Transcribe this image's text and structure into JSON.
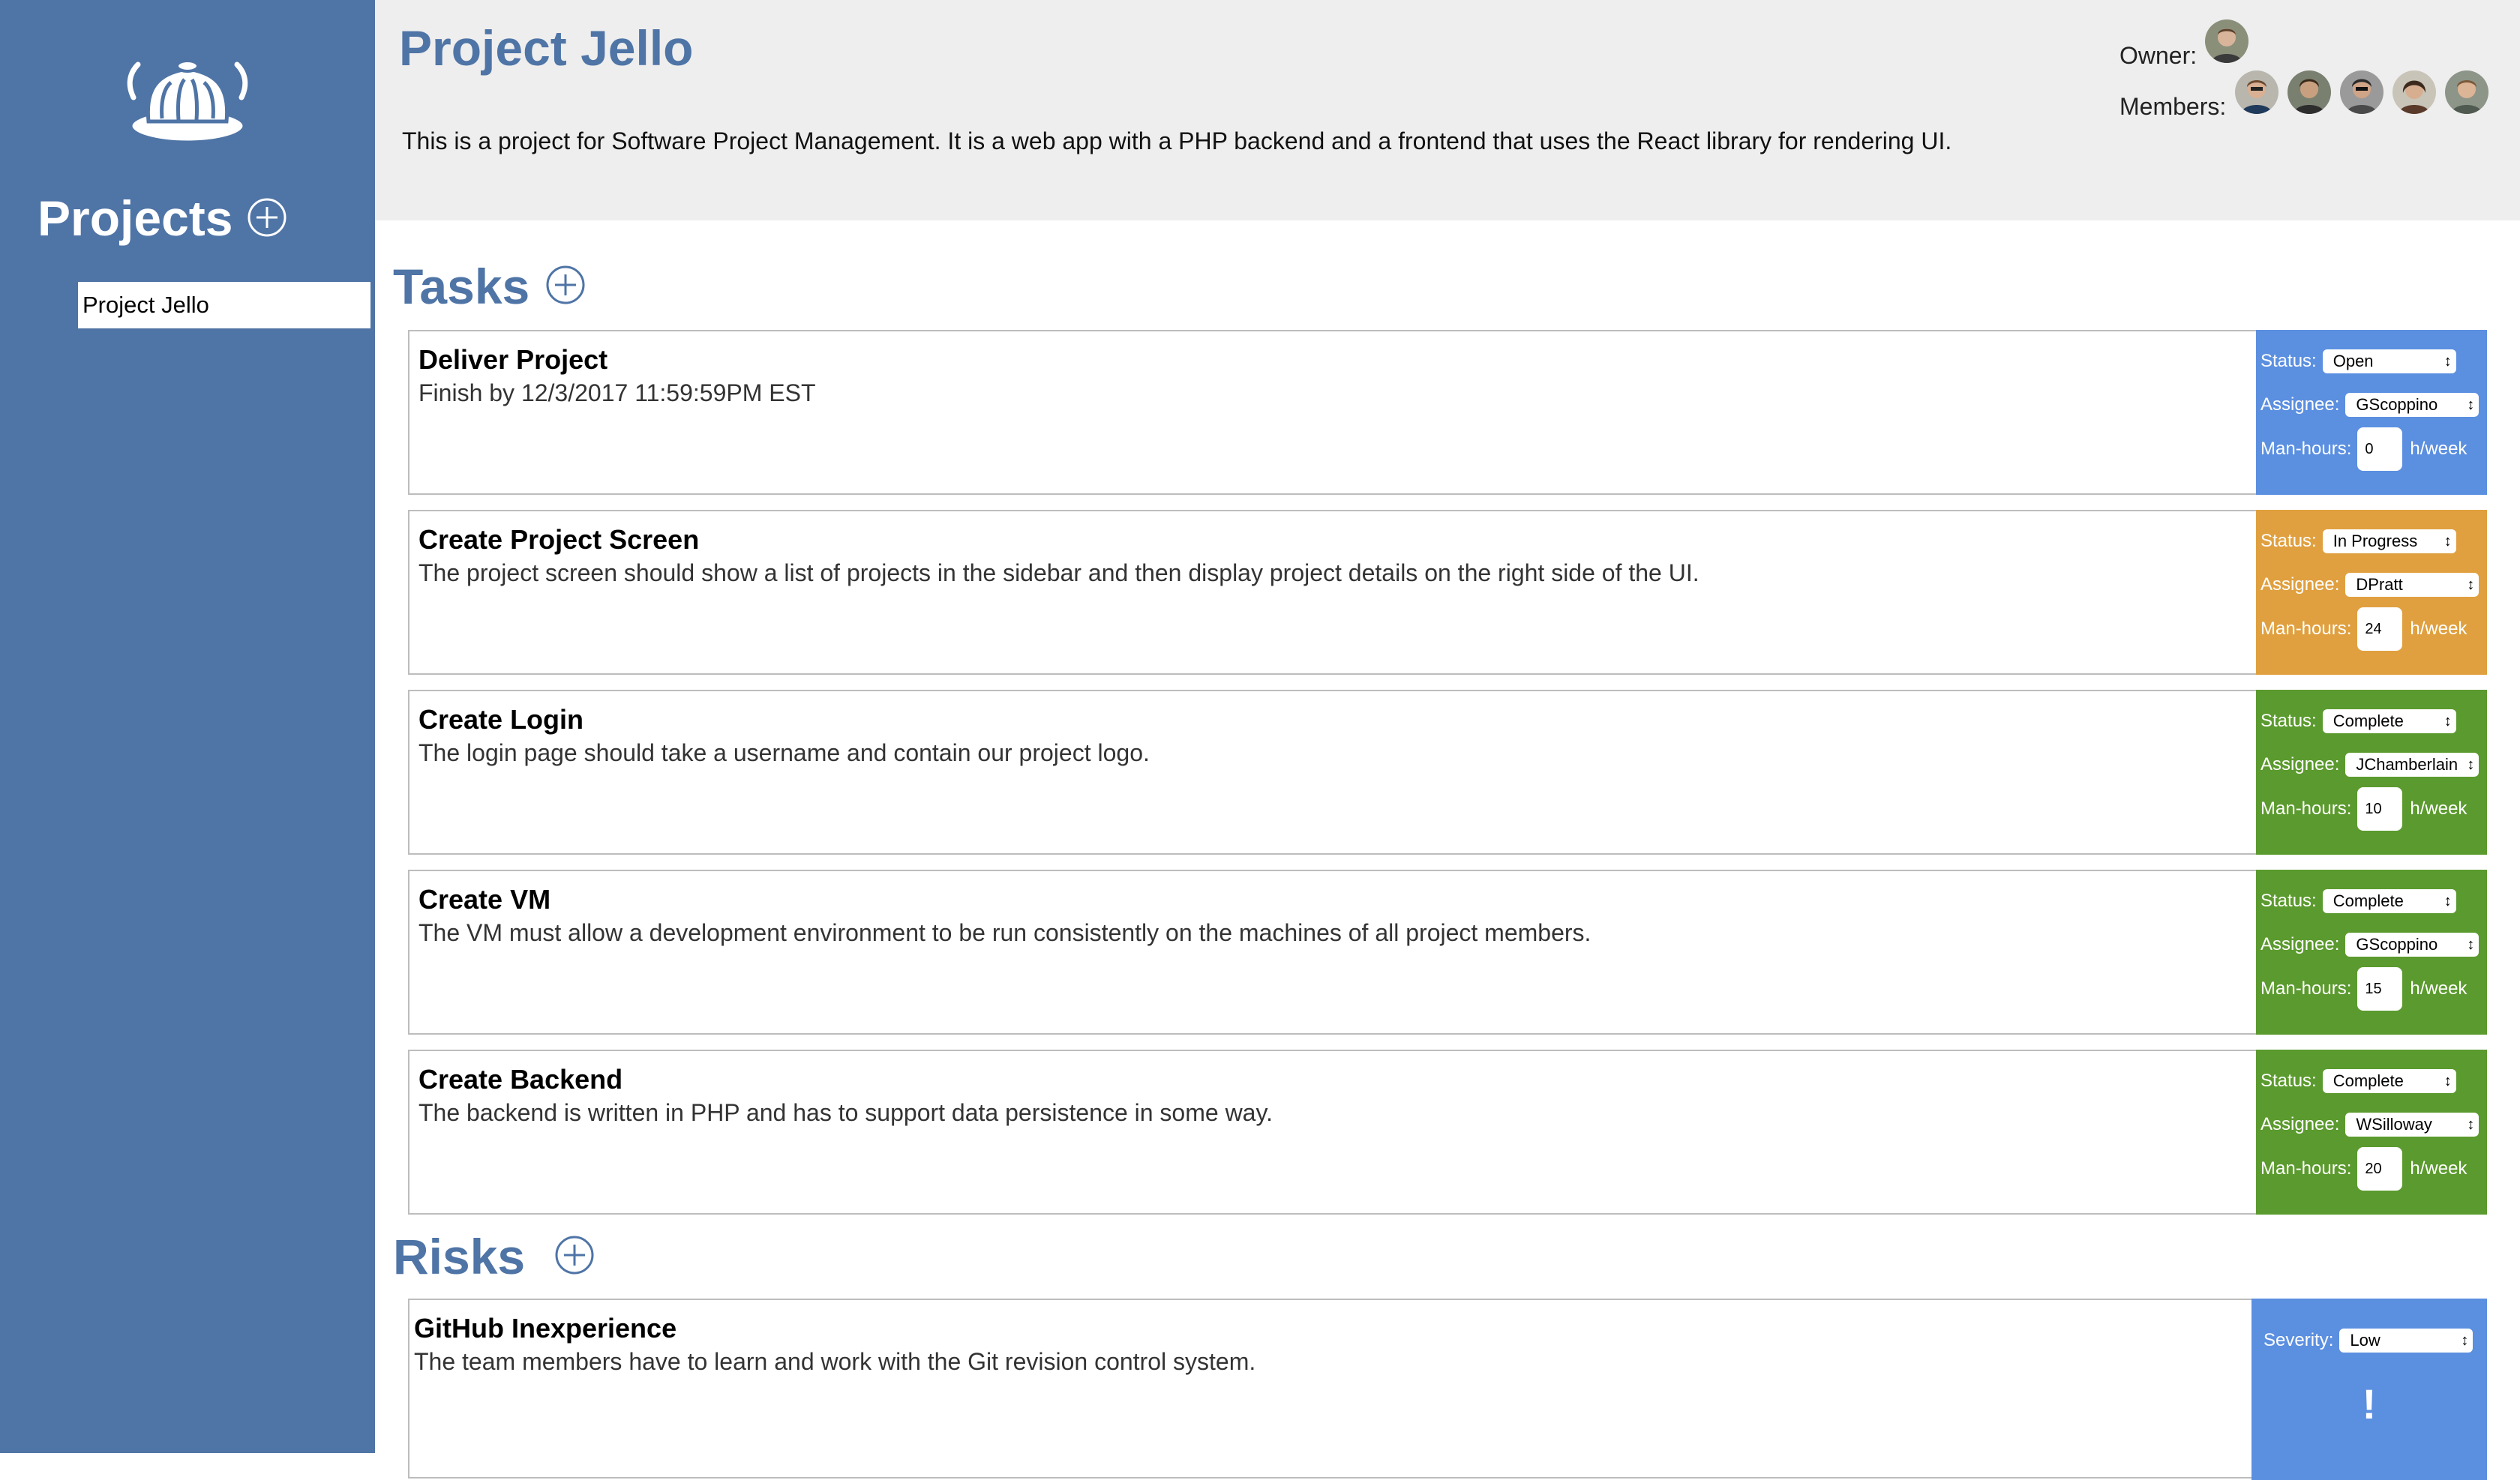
{
  "sidebar": {
    "heading": "Projects",
    "projects": [
      {
        "label": "Project Jello"
      }
    ]
  },
  "project": {
    "title": "Project Jello",
    "description": "This is a project for Software Project Management. It is a web app with a PHP backend and a frontend that uses the React library for rendering UI.",
    "owner_label": "Owner:",
    "members_label": "Members:"
  },
  "tasks_section": {
    "title": "Tasks",
    "items": [
      {
        "title": "Deliver Project",
        "description": "Finish by 12/3/2017 11:59:59PM EST",
        "status": "Open",
        "assignee": "GScoppino",
        "hours": "0",
        "color": "#5b8fe0"
      },
      {
        "title": "Create Project Screen",
        "description": "The project screen should show a list of projects in the sidebar and then display project details on the right side of the UI.",
        "status": "In Progress",
        "assignee": "DPratt",
        "hours": "24",
        "color": "#e0a03f"
      },
      {
        "title": "Create Login",
        "description": "The login page should take a username and contain our project logo.",
        "status": "Complete",
        "assignee": "JChamberlain",
        "hours": "10",
        "color": "#5b9a2e"
      },
      {
        "title": "Create VM",
        "description": "The VM must allow a development environment to be run consistently on the machines of all project members.",
        "status": "Complete",
        "assignee": "GScoppino",
        "hours": "15",
        "color": "#5b9a2e"
      },
      {
        "title": "Create Backend",
        "description": "The backend is written in PHP and has to support data persistence in some way.",
        "status": "Complete",
        "assignee": "WSilloway",
        "hours": "20",
        "color": "#5b9a2e"
      }
    ],
    "labels": {
      "status": "Status:",
      "assignee": "Assignee:",
      "hours": "Man-hours:",
      "unit": "h/week"
    }
  },
  "risks_section": {
    "title": "Risks",
    "items": [
      {
        "title": "GitHub Inexperience",
        "description": "The team members have to learn and work with the Git revision control system.",
        "severity": "Low",
        "indicator": "!",
        "color": "#5b8fe0"
      }
    ],
    "labels": {
      "severity": "Severity:"
    }
  },
  "colors": {
    "sidebar": "#4f74a6",
    "accent": "#4f74a6",
    "header_bg": "#eeeeee",
    "open": "#5b8fe0",
    "in_progress": "#e0a03f",
    "complete": "#5b9a2e"
  },
  "icons": {
    "logo": "jello-logo-icon",
    "add": "plus-circle-icon",
    "avatar": "user-avatar-icon"
  }
}
